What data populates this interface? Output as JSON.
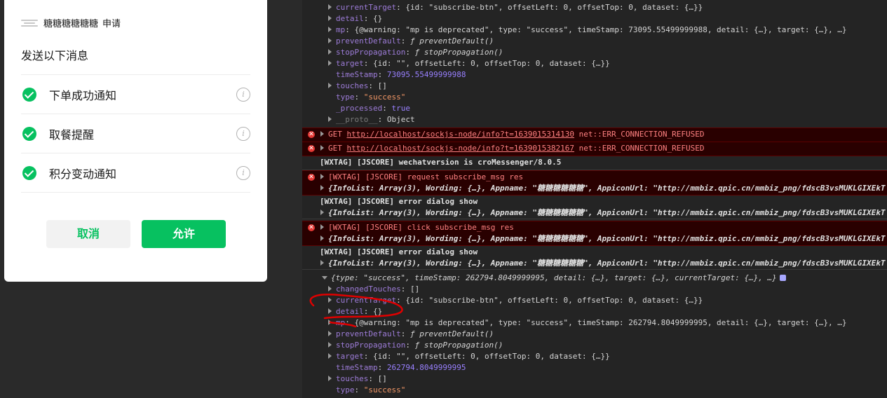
{
  "dialog": {
    "app_name": "糖糖糖糖糖糖",
    "app_suffix": "申请",
    "title": "发送以下消息",
    "options": [
      {
        "label": "下单成功通知",
        "checked": true
      },
      {
        "label": "取餐提醒",
        "checked": true
      },
      {
        "label": "积分变动通知",
        "checked": true
      }
    ],
    "info_glyph": "i",
    "cancel_label": "取消",
    "allow_label": "允许",
    "accent_color": "#07c160"
  },
  "console": {
    "top_props": [
      {
        "key": "currentTarget",
        "value": "{id: \"subscribe-btn\", offsetLeft: 0, offsetTop: 0, dataset: {…}}",
        "expandable": true
      },
      {
        "key": "detail",
        "value": "{}",
        "expandable": true
      },
      {
        "key": "mp",
        "value": "{@warning: \"mp is deprecated\", type: \"success\", timeStamp: 73095.55499999988, detail: {…}, target: {…}, …}",
        "expandable": true
      },
      {
        "key": "preventDefault",
        "value": "ƒ preventDefault()",
        "expandable": true
      },
      {
        "key": "stopPropagation",
        "value": "ƒ stopPropagation()",
        "expandable": true
      },
      {
        "key": "target",
        "value": "{id: \"\", offsetLeft: 0, offsetTop: 0, dataset: {…}}",
        "expandable": true
      },
      {
        "key": "timeStamp",
        "value": "73095.55499999988",
        "expandable": false
      },
      {
        "key": "touches",
        "value": "[]",
        "expandable": true
      },
      {
        "key": "type",
        "value": "\"success\"",
        "expandable": false
      },
      {
        "key": "_processed",
        "value": "true",
        "expandable": false
      },
      {
        "key": "__proto__",
        "value": "Object",
        "expandable": true
      }
    ],
    "errors": [
      {
        "method": "GET",
        "url": "http://localhost/sockjs-node/info?t=1639015314130",
        "status": "net::ERR_CONNECTION_REFUSED"
      },
      {
        "method": "GET",
        "url": "http://localhost/sockjs-node/info?t=1639015382167",
        "status": "net::ERR_CONNECTION_REFUSED"
      }
    ],
    "version_line": "[WXTAG] [JSCORE] wechatversion is croMessenger/8.0.5",
    "request_line": "[WXTAG] [JSCORE] request subscribe_msg res",
    "infolist_line": "{InfoList: Array(3), Wording: {…}, Appname: \"糖糖糖糖糖糖\", AppiconUrl: \"http://mmbiz.qpic.cn/mmbiz_png/fdscB3vsMUKLGIXEkT",
    "error_dialog_line": "[WXTAG] [JSCORE] error dialog show",
    "click_line": "[WXTAG] [JSCORE] click subscribe_msg res",
    "event_summary": "{type: \"success\", timeStamp: 262794.8049999995, detail: {…}, target: {…}, currentTarget: {…}, …}",
    "bottom_props": [
      {
        "key": "changedTouches",
        "value": "[]",
        "expandable": true
      },
      {
        "key": "currentTarget",
        "value": "{id: \"subscribe-btn\", offsetLeft: 0, offsetTop: 0, dataset: {…}}",
        "expandable": true
      },
      {
        "key": "detail",
        "value": "{}",
        "expandable": true
      },
      {
        "key": "mp",
        "value": "{@warning: \"mp is deprecated\", type: \"success\", timeStamp: 262794.8049999995, detail: {…}, target: {…}, …}",
        "expandable": true
      },
      {
        "key": "preventDefault",
        "value": "ƒ preventDefault()",
        "expandable": true
      },
      {
        "key": "stopPropagation",
        "value": "ƒ stopPropagation()",
        "expandable": true
      },
      {
        "key": "target",
        "value": "{id: \"\", offsetLeft: 0, offsetTop: 0, dataset: {…}}",
        "expandable": true
      },
      {
        "key": "timeStamp",
        "value": "262794.8049999995",
        "expandable": false
      },
      {
        "key": "touches",
        "value": "[]",
        "expandable": true
      },
      {
        "key": "type",
        "value": "\"success\"",
        "expandable": false
      }
    ],
    "error_color": "#ff8080",
    "annotation_color": "#e00000"
  }
}
